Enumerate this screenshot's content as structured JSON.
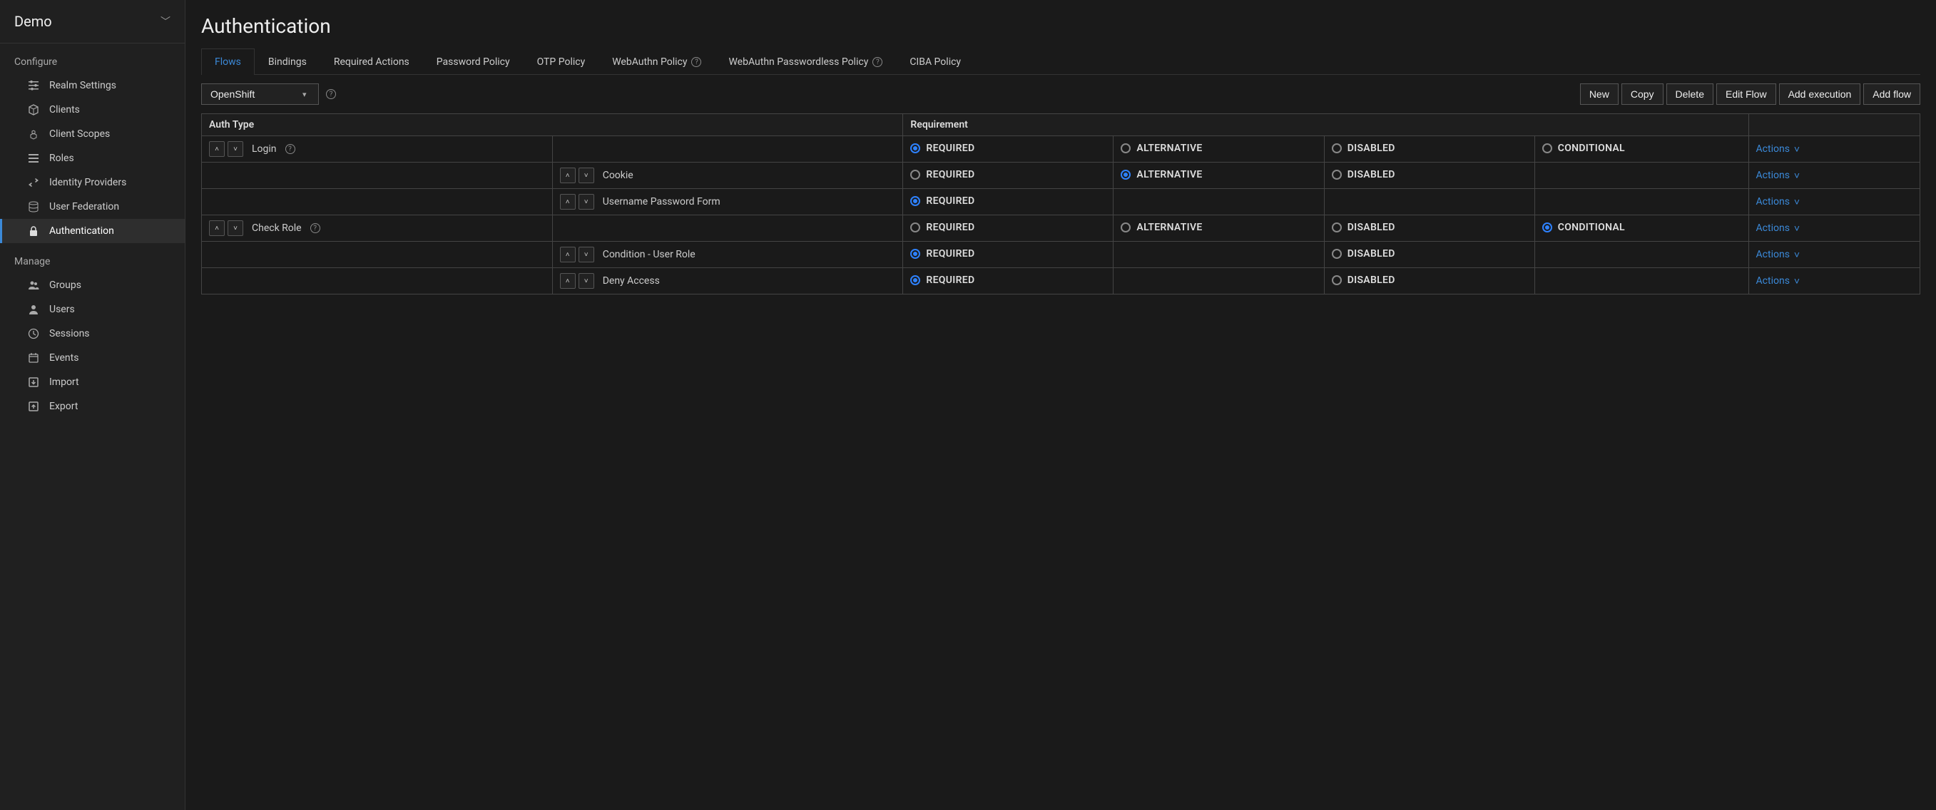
{
  "realm": {
    "name": "Demo"
  },
  "sidebar": {
    "sections": [
      {
        "title": "Configure",
        "items": [
          {
            "label": "Realm Settings",
            "icon": "sliders-icon",
            "active": false
          },
          {
            "label": "Clients",
            "icon": "cube-icon",
            "active": false
          },
          {
            "label": "Client Scopes",
            "icon": "cubes-icon",
            "active": false
          },
          {
            "label": "Roles",
            "icon": "list-icon",
            "active": false
          },
          {
            "label": "Identity Providers",
            "icon": "exchange-icon",
            "active": false
          },
          {
            "label": "User Federation",
            "icon": "database-icon",
            "active": false
          },
          {
            "label": "Authentication",
            "icon": "lock-icon",
            "active": true
          }
        ]
      },
      {
        "title": "Manage",
        "items": [
          {
            "label": "Groups",
            "icon": "users-icon",
            "active": false
          },
          {
            "label": "Users",
            "icon": "user-icon",
            "active": false
          },
          {
            "label": "Sessions",
            "icon": "clock-icon",
            "active": false
          },
          {
            "label": "Events",
            "icon": "calendar-icon",
            "active": false
          },
          {
            "label": "Import",
            "icon": "import-icon",
            "active": false
          },
          {
            "label": "Export",
            "icon": "export-icon",
            "active": false
          }
        ]
      }
    ]
  },
  "page": {
    "title": "Authentication"
  },
  "tabs": [
    {
      "label": "Flows",
      "active": true,
      "help": false
    },
    {
      "label": "Bindings",
      "active": false,
      "help": false
    },
    {
      "label": "Required Actions",
      "active": false,
      "help": false
    },
    {
      "label": "Password Policy",
      "active": false,
      "help": false
    },
    {
      "label": "OTP Policy",
      "active": false,
      "help": false
    },
    {
      "label": "WebAuthn Policy",
      "active": false,
      "help": true
    },
    {
      "label": "WebAuthn Passwordless Policy",
      "active": false,
      "help": true
    },
    {
      "label": "CIBA Policy",
      "active": false,
      "help": false
    }
  ],
  "toolbar": {
    "flow_selected": "OpenShift",
    "buttons": {
      "new": "New",
      "copy": "Copy",
      "delete": "Delete",
      "edit_flow": "Edit Flow",
      "add_execution": "Add execution",
      "add_flow": "Add flow"
    }
  },
  "table": {
    "headers": {
      "auth_type": "Auth Type",
      "requirement": "Requirement"
    },
    "req_labels": {
      "required": "REQUIRED",
      "alternative": "ALTERNATIVE",
      "disabled": "DISABLED",
      "conditional": "CONDITIONAL"
    },
    "actions_label": "Actions",
    "rows": [
      {
        "indent": 0,
        "name": "Login",
        "help": true,
        "options": [
          "required",
          "alternative",
          "disabled",
          "conditional"
        ],
        "selected": "required"
      },
      {
        "indent": 1,
        "name": "Cookie",
        "help": false,
        "options": [
          "required",
          "alternative",
          "disabled"
        ],
        "selected": "alternative"
      },
      {
        "indent": 1,
        "name": "Username Password Form",
        "help": false,
        "options": [
          "required"
        ],
        "selected": "required"
      },
      {
        "indent": 0,
        "name": "Check Role",
        "help": true,
        "options": [
          "required",
          "alternative",
          "disabled",
          "conditional"
        ],
        "selected": "conditional"
      },
      {
        "indent": 1,
        "name": "Condition - User Role",
        "help": false,
        "options": [
          "required",
          "disabled"
        ],
        "selected": "required"
      },
      {
        "indent": 1,
        "name": "Deny Access",
        "help": false,
        "options": [
          "required",
          "disabled"
        ],
        "selected": "required"
      }
    ]
  }
}
